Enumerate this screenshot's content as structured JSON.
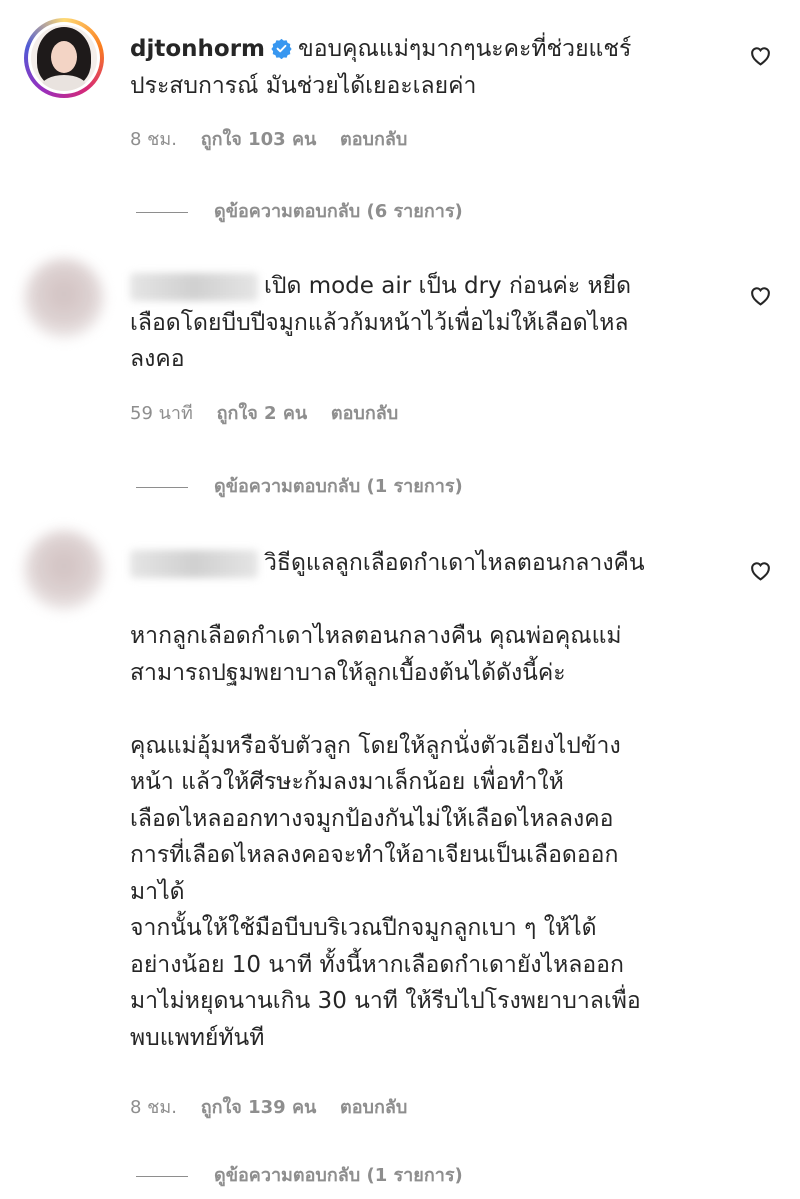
{
  "comments": [
    {
      "username": "djtonhorm",
      "verified": true,
      "text": "ขอบคุณแม่ๆมากๆนะคะที่ช่วยแชร์\nประสบการณ์ มันช่วยได้เยอะเลยค่า",
      "time": "8 ชม.",
      "likes": "ถูกใจ 103 คน",
      "reply": "ตอบกลับ",
      "view_replies": "ดูข้อความตอบกลับ (6 รายการ)"
    },
    {
      "username": "",
      "text": "เปิด mode air เป็น dry ก่อนค่ะ หยีด\nเลือดโดยบีบปีจมูกแล้วก้มหน้าไว้เพื่อไม่ให้เลือดไหล\nลงคอ",
      "time": "59 นาที",
      "likes": "ถูกใจ 2 คน",
      "reply": "ตอบกลับ",
      "view_replies": "ดูข้อความตอบกลับ (1 รายการ)"
    },
    {
      "username": "",
      "text": "วิธีดูแลลูกเลือดกำเดาไหลตอนกลางคืน\n\nหากลูกเลือดกำเดาไหลตอนกลางคืน คุณพ่อคุณแม่\nสามารถปฐมพยาบาลให้ลูกเบื้องต้นได้ดังนี้ค่ะ\n\nคุณแม่อุ้มหรือจับตัวลูก โดยให้ลูกนั่งตัวเอียงไปข้าง\nหน้า แล้วให้ศีรษะก้มลงมาเล็กน้อย เพื่อทำให้\nเลือดไหลออกทางจมูกป้องกันไม่ให้เลือดไหลลงคอ\nการที่เลือดไหลลงคอจะทำให้อาเจียนเป็นเลือดออก\nมาได้\nจากนั้นให้ใช้มือบีบบริเวณปีกจมูกลูกเบา ๆ ให้ได้\nอย่างน้อย 10 นาที ทั้งนี้หากเลือดกำเดายังไหลออก\nมาไม่หยุดนานเกิน 30 นาที ให้รีบไปโรงพยาบาลเพื่อ\nพบแพทย์ทันที",
      "time": "8 ชม.",
      "likes": "ถูกใจ 139 คน",
      "reply": "ตอบกลับ",
      "view_replies": "ดูข้อความตอบกลับ (1 รายการ)"
    }
  ],
  "icons": {
    "verified": "verified-badge-icon",
    "like": "heart-outline-icon"
  },
  "colors": {
    "text": "#262626",
    "secondary": "#8e8e8e",
    "verified_blue": "#3897f0"
  }
}
